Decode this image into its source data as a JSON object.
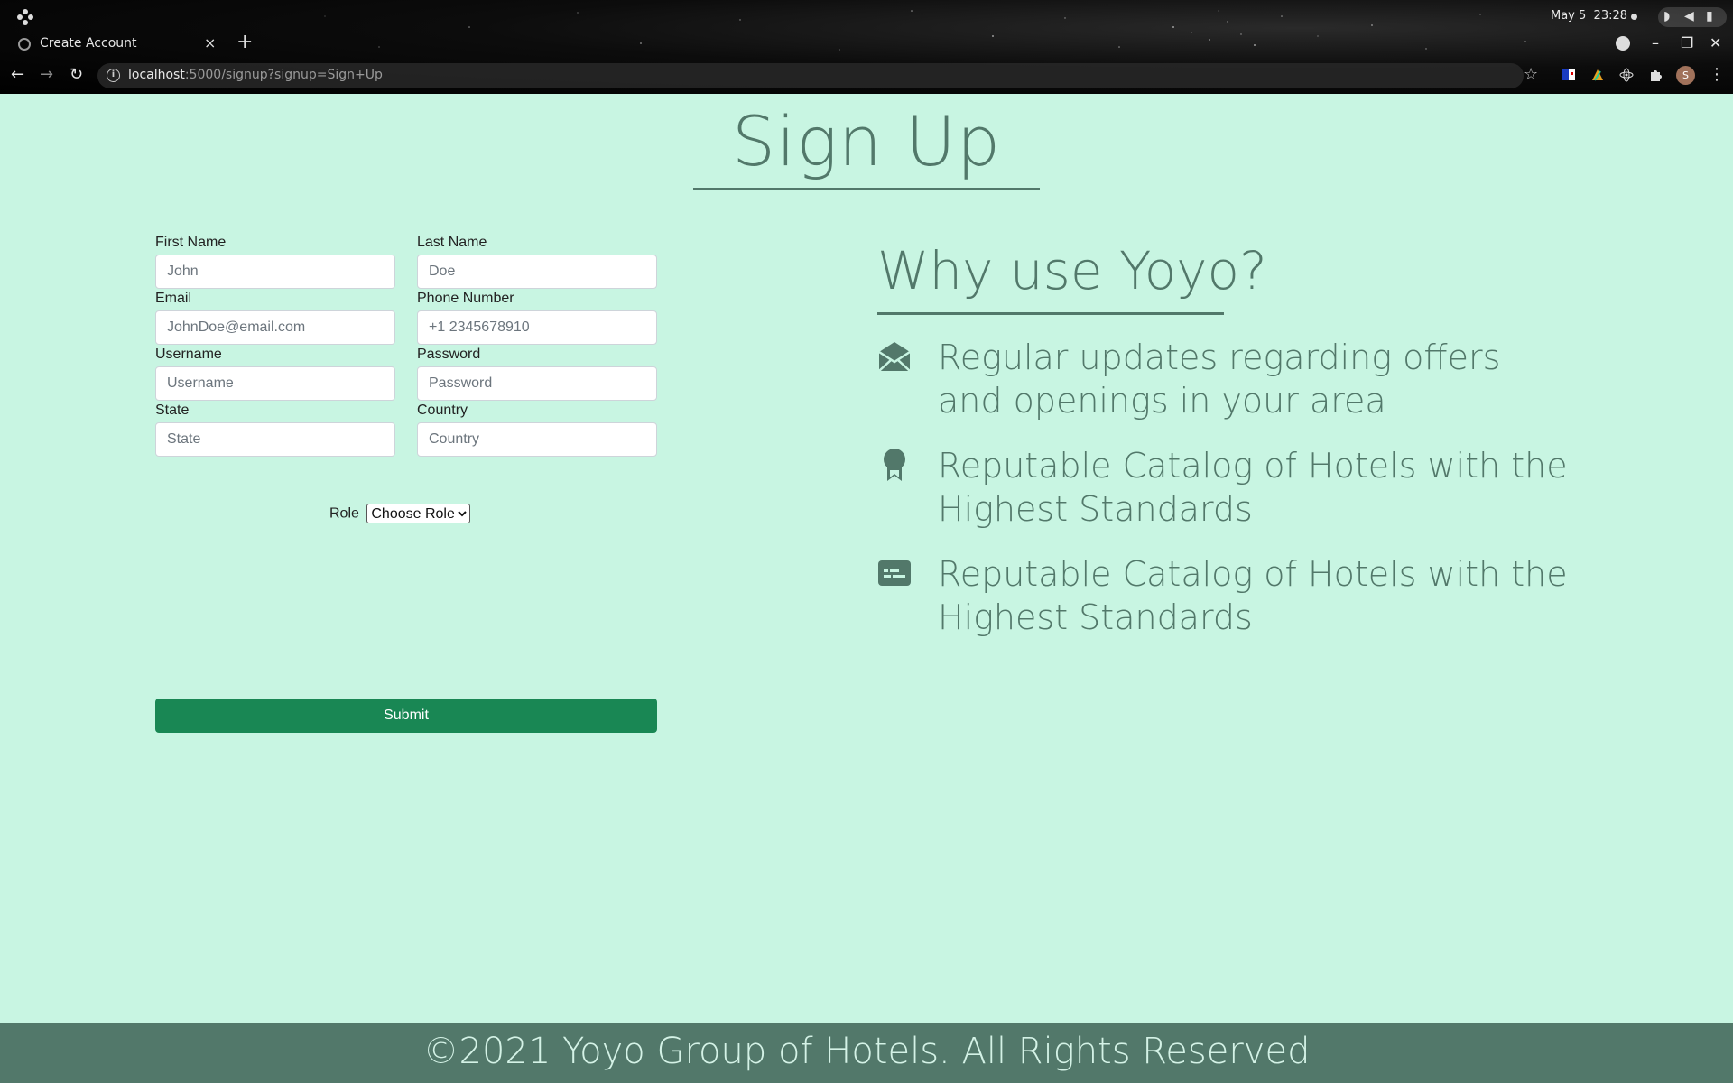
{
  "os": {
    "date": "May 5",
    "time": "23:28"
  },
  "browser": {
    "tab_title": "Create Account",
    "tab_close": "×",
    "new_tab": "+",
    "url_host": "localhost",
    "url_rest": ":5000/signup?signup=Sign+Up"
  },
  "page": {
    "title": "Sign Up",
    "form": {
      "fields": [
        {
          "label": "First Name",
          "placeholder": "John"
        },
        {
          "label": "Last Name",
          "placeholder": "Doe"
        },
        {
          "label": "Email",
          "placeholder": "JohnDoe@email.com"
        },
        {
          "label": "Phone Number",
          "placeholder": "+1 2345678910"
        },
        {
          "label": "Username",
          "placeholder": "Username"
        },
        {
          "label": "Password",
          "placeholder": "Password"
        },
        {
          "label": "State",
          "placeholder": "State"
        },
        {
          "label": "Country",
          "placeholder": "Country"
        }
      ],
      "role_label": "Role",
      "role_selected": "Choose Role",
      "submit_label": "Submit"
    },
    "why": {
      "title": "Why use Yoyo?",
      "items": [
        {
          "icon": "envelope-open-icon",
          "text": "Regular updates regarding offers and openings in your area"
        },
        {
          "icon": "award-icon",
          "text": "Reputable Catalog of Hotels with the Highest Standards"
        },
        {
          "icon": "card-icon",
          "text": "Reputable Catalog of Hotels with the Highest Standards"
        }
      ]
    },
    "footer": "©2021 Yoyo Group of Hotels. All Rights Reserved"
  },
  "colors": {
    "page_bg": "#c8f5e2",
    "accent": "#52786a",
    "submit": "#198754"
  }
}
